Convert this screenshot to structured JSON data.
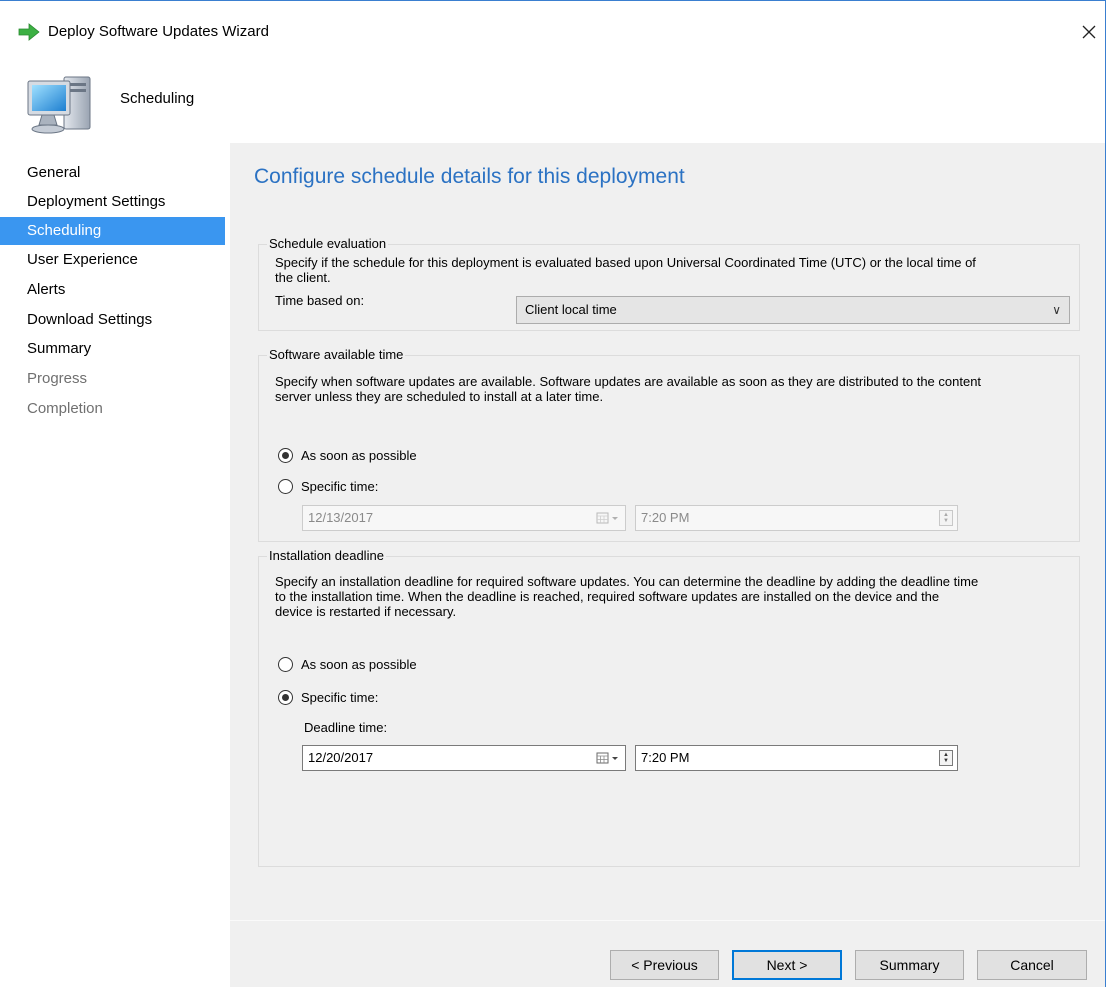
{
  "window": {
    "title": "Deploy Software Updates Wizard"
  },
  "header": {
    "title": "Scheduling"
  },
  "sidebar": {
    "items": [
      {
        "label": "General",
        "state": "normal"
      },
      {
        "label": "Deployment Settings",
        "state": "normal"
      },
      {
        "label": "Scheduling",
        "state": "active"
      },
      {
        "label": "User Experience",
        "state": "normal"
      },
      {
        "label": "Alerts",
        "state": "normal"
      },
      {
        "label": "Download Settings",
        "state": "normal"
      },
      {
        "label": "Summary",
        "state": "normal"
      },
      {
        "label": "Progress",
        "state": "disabled"
      },
      {
        "label": "Completion",
        "state": "disabled"
      }
    ]
  },
  "main": {
    "heading": "Configure schedule details for this deployment",
    "schedule_evaluation": {
      "legend": "Schedule evaluation",
      "description_line1": "Specify if the schedule for this deployment is evaluated based upon Universal Coordinated Time (UTC) or the local time of",
      "description_line2": "the client.",
      "time_based_on_label": "Time based on:",
      "time_based_on_value": "Client local time"
    },
    "software_available": {
      "legend": "Software available time",
      "description_line1": "Specify when software updates are available. Software updates are available as soon as they are distributed to the content",
      "description_line2": "server unless they are scheduled to install at a later time.",
      "option_asap": "As soon as possible",
      "option_specific": "Specific time:",
      "selected": "asap",
      "date": "12/13/2017",
      "time": "7:20 PM"
    },
    "installation_deadline": {
      "legend": "Installation deadline",
      "description_line1": "Specify an installation deadline for required software updates. You can determine the deadline by adding the deadline time",
      "description_line2": "to the installation time. When the deadline is reached, required software updates are installed on the device and the",
      "description_line3": "device is restarted if necessary.",
      "option_asap": "As soon as possible",
      "option_specific": "Specific time:",
      "selected": "specific",
      "deadline_label": "Deadline time:",
      "date": "12/20/2017",
      "time": "7:20 PM"
    }
  },
  "footer": {
    "previous_label": "< Previous",
    "next_label": "Next >",
    "summary_label": "Summary",
    "cancel_label": "Cancel"
  },
  "colors": {
    "accent": "#2b72c3",
    "nav_selected": "#3a96f0",
    "title_arrow": "#3cb043"
  }
}
